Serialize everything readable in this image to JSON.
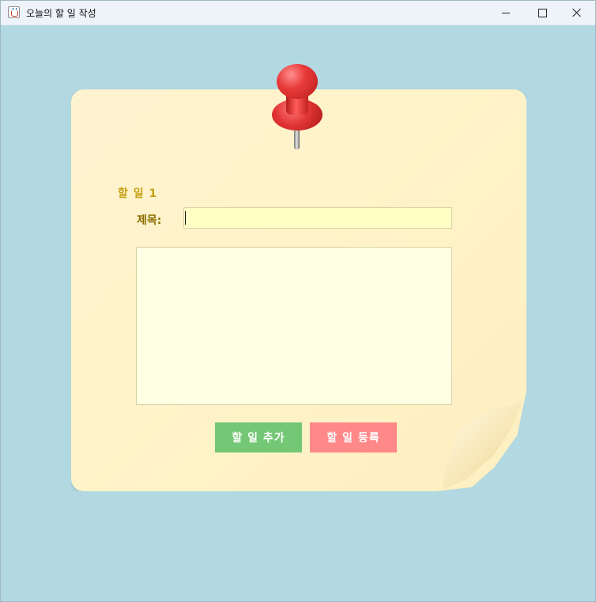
{
  "window": {
    "title": "오늘의 할 일 작성",
    "app_icon": "java-cup-icon",
    "controls": [
      "minimize-icon",
      "maximize-icon",
      "close-icon"
    ]
  },
  "note": {
    "heading": "할 일 1",
    "title_label": "제목:",
    "title_value": "",
    "content_value": "",
    "pin_icon": "pushpin-icon"
  },
  "buttons": {
    "add": "할 일 추가",
    "register": "할 일 등록"
  },
  "colors": {
    "background": "#b2d8e2",
    "note": "#fff3c9",
    "heading": "#c5a013",
    "label": "#8a6d00",
    "input": "#ffffc6",
    "textarea": "#ffffe4",
    "add_button": "#74c775",
    "register_button": "#ff8888",
    "pin": "#e83a3a"
  }
}
